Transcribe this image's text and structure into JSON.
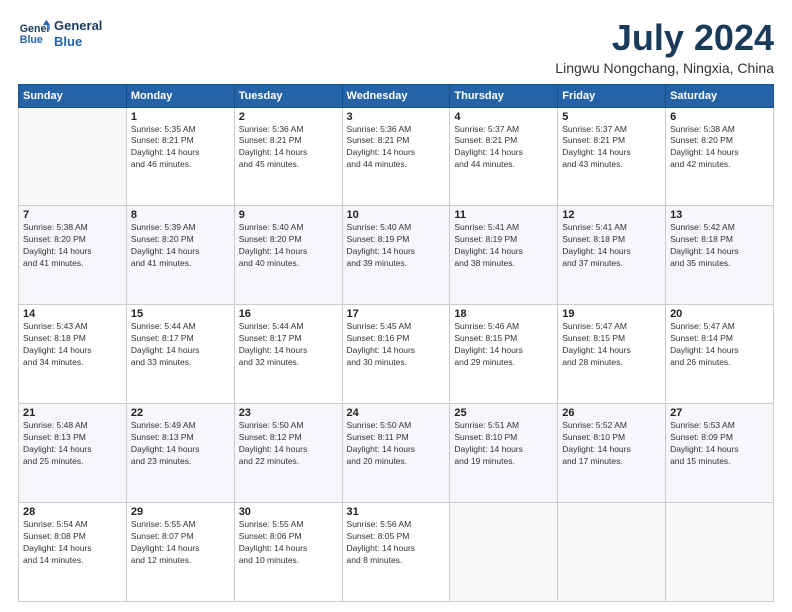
{
  "header": {
    "logo_line1": "General",
    "logo_line2": "Blue",
    "title": "July 2024",
    "location": "Lingwu Nongchang, Ningxia, China"
  },
  "days_of_week": [
    "Sunday",
    "Monday",
    "Tuesday",
    "Wednesday",
    "Thursday",
    "Friday",
    "Saturday"
  ],
  "weeks": [
    [
      {
        "day": "",
        "info": ""
      },
      {
        "day": "1",
        "info": "Sunrise: 5:35 AM\nSunset: 8:21 PM\nDaylight: 14 hours\nand 46 minutes."
      },
      {
        "day": "2",
        "info": "Sunrise: 5:36 AM\nSunset: 8:21 PM\nDaylight: 14 hours\nand 45 minutes."
      },
      {
        "day": "3",
        "info": "Sunrise: 5:36 AM\nSunset: 8:21 PM\nDaylight: 14 hours\nand 44 minutes."
      },
      {
        "day": "4",
        "info": "Sunrise: 5:37 AM\nSunset: 8:21 PM\nDaylight: 14 hours\nand 44 minutes."
      },
      {
        "day": "5",
        "info": "Sunrise: 5:37 AM\nSunset: 8:21 PM\nDaylight: 14 hours\nand 43 minutes."
      },
      {
        "day": "6",
        "info": "Sunrise: 5:38 AM\nSunset: 8:20 PM\nDaylight: 14 hours\nand 42 minutes."
      }
    ],
    [
      {
        "day": "7",
        "info": "Sunrise: 5:38 AM\nSunset: 8:20 PM\nDaylight: 14 hours\nand 41 minutes."
      },
      {
        "day": "8",
        "info": "Sunrise: 5:39 AM\nSunset: 8:20 PM\nDaylight: 14 hours\nand 41 minutes."
      },
      {
        "day": "9",
        "info": "Sunrise: 5:40 AM\nSunset: 8:20 PM\nDaylight: 14 hours\nand 40 minutes."
      },
      {
        "day": "10",
        "info": "Sunrise: 5:40 AM\nSunset: 8:19 PM\nDaylight: 14 hours\nand 39 minutes."
      },
      {
        "day": "11",
        "info": "Sunrise: 5:41 AM\nSunset: 8:19 PM\nDaylight: 14 hours\nand 38 minutes."
      },
      {
        "day": "12",
        "info": "Sunrise: 5:41 AM\nSunset: 8:18 PM\nDaylight: 14 hours\nand 37 minutes."
      },
      {
        "day": "13",
        "info": "Sunrise: 5:42 AM\nSunset: 8:18 PM\nDaylight: 14 hours\nand 35 minutes."
      }
    ],
    [
      {
        "day": "14",
        "info": "Sunrise: 5:43 AM\nSunset: 8:18 PM\nDaylight: 14 hours\nand 34 minutes."
      },
      {
        "day": "15",
        "info": "Sunrise: 5:44 AM\nSunset: 8:17 PM\nDaylight: 14 hours\nand 33 minutes."
      },
      {
        "day": "16",
        "info": "Sunrise: 5:44 AM\nSunset: 8:17 PM\nDaylight: 14 hours\nand 32 minutes."
      },
      {
        "day": "17",
        "info": "Sunrise: 5:45 AM\nSunset: 8:16 PM\nDaylight: 14 hours\nand 30 minutes."
      },
      {
        "day": "18",
        "info": "Sunrise: 5:46 AM\nSunset: 8:15 PM\nDaylight: 14 hours\nand 29 minutes."
      },
      {
        "day": "19",
        "info": "Sunrise: 5:47 AM\nSunset: 8:15 PM\nDaylight: 14 hours\nand 28 minutes."
      },
      {
        "day": "20",
        "info": "Sunrise: 5:47 AM\nSunset: 8:14 PM\nDaylight: 14 hours\nand 26 minutes."
      }
    ],
    [
      {
        "day": "21",
        "info": "Sunrise: 5:48 AM\nSunset: 8:13 PM\nDaylight: 14 hours\nand 25 minutes."
      },
      {
        "day": "22",
        "info": "Sunrise: 5:49 AM\nSunset: 8:13 PM\nDaylight: 14 hours\nand 23 minutes."
      },
      {
        "day": "23",
        "info": "Sunrise: 5:50 AM\nSunset: 8:12 PM\nDaylight: 14 hours\nand 22 minutes."
      },
      {
        "day": "24",
        "info": "Sunrise: 5:50 AM\nSunset: 8:11 PM\nDaylight: 14 hours\nand 20 minutes."
      },
      {
        "day": "25",
        "info": "Sunrise: 5:51 AM\nSunset: 8:10 PM\nDaylight: 14 hours\nand 19 minutes."
      },
      {
        "day": "26",
        "info": "Sunrise: 5:52 AM\nSunset: 8:10 PM\nDaylight: 14 hours\nand 17 minutes."
      },
      {
        "day": "27",
        "info": "Sunrise: 5:53 AM\nSunset: 8:09 PM\nDaylight: 14 hours\nand 15 minutes."
      }
    ],
    [
      {
        "day": "28",
        "info": "Sunrise: 5:54 AM\nSunset: 8:08 PM\nDaylight: 14 hours\nand 14 minutes."
      },
      {
        "day": "29",
        "info": "Sunrise: 5:55 AM\nSunset: 8:07 PM\nDaylight: 14 hours\nand 12 minutes."
      },
      {
        "day": "30",
        "info": "Sunrise: 5:55 AM\nSunset: 8:06 PM\nDaylight: 14 hours\nand 10 minutes."
      },
      {
        "day": "31",
        "info": "Sunrise: 5:56 AM\nSunset: 8:05 PM\nDaylight: 14 hours\nand 8 minutes."
      },
      {
        "day": "",
        "info": ""
      },
      {
        "day": "",
        "info": ""
      },
      {
        "day": "",
        "info": ""
      }
    ]
  ]
}
